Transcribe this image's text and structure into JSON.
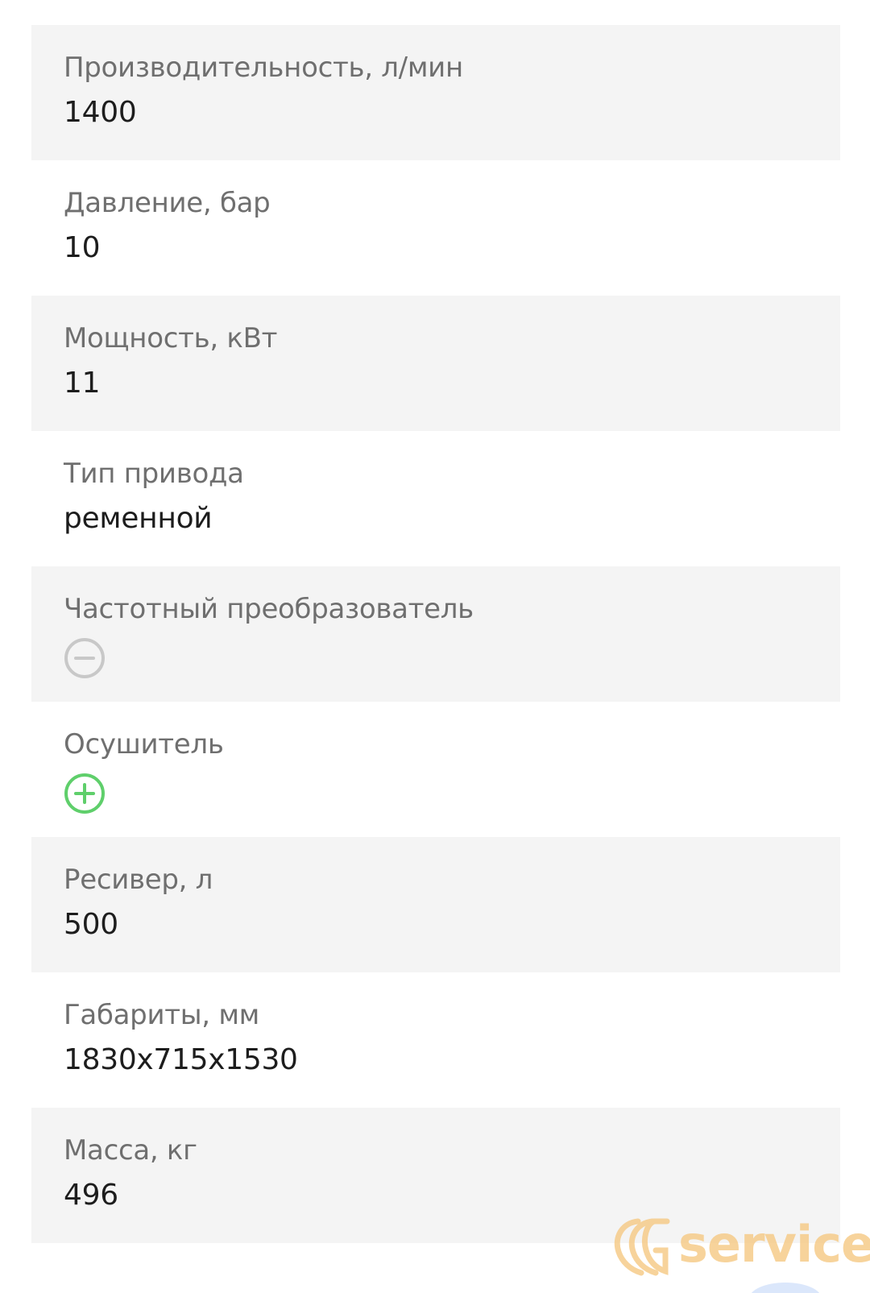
{
  "specs": [
    {
      "label": "Производительность, л/мин",
      "value": "1400"
    },
    {
      "label": "Давление, бар",
      "value": "10"
    },
    {
      "label": "Мощность, кВт",
      "value": "11"
    },
    {
      "label": "Тип привода",
      "value": "ременной"
    },
    {
      "label": "Частотный преобразователь",
      "icon": "minus-circle-icon",
      "icon_color": "#c8c8c8"
    },
    {
      "label": "Осушитель",
      "icon": "plus-circle-icon",
      "icon_color": "#5fcf6b"
    },
    {
      "label": "Ресивер, л",
      "value": "500"
    },
    {
      "label": "Габариты, мм",
      "value": "1830x715x1530"
    },
    {
      "label": "Масса, кг",
      "value": "496"
    }
  ],
  "watermark": {
    "text": "service",
    "color": "#f6cc8a"
  },
  "colors": {
    "row_shaded": "#f4f4f4",
    "label": "#6f6f6f",
    "value": "#1d1d1d"
  }
}
